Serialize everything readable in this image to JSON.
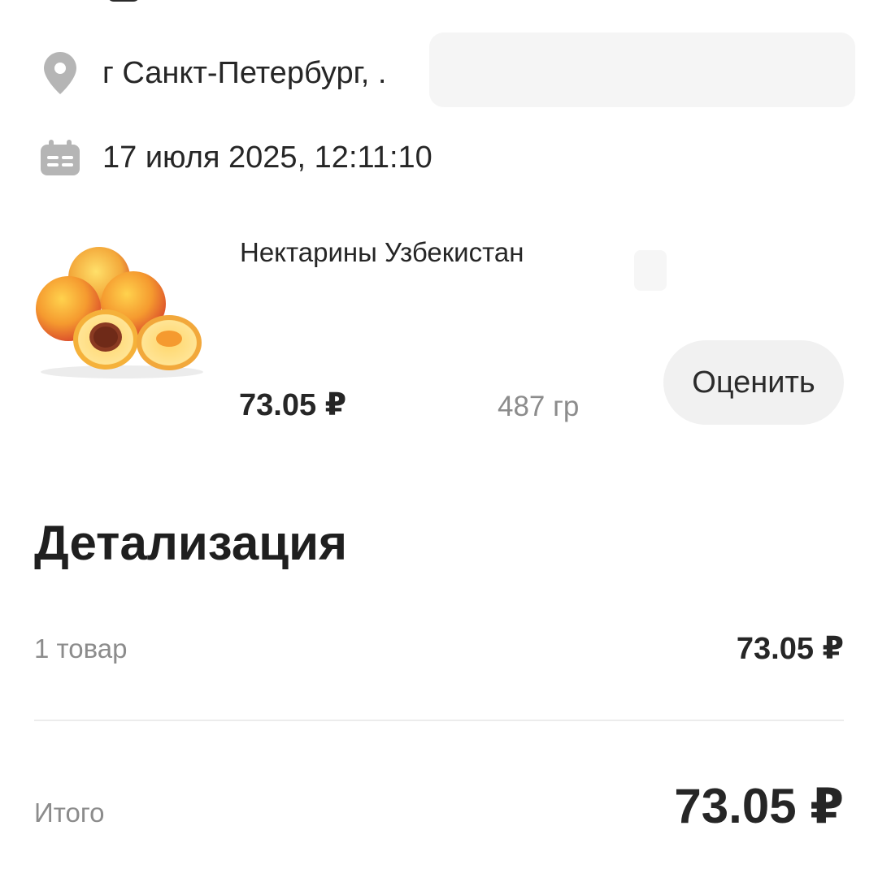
{
  "order": {
    "address": "г Санкт-Петербург, .",
    "datetime": "17 июля 2025, 12:11:10"
  },
  "item": {
    "name": "Нектарины Узбекистан",
    "price": "73.05 ₽",
    "weight": "487 гр",
    "rate_label": "Оценить",
    "image_icon": "nectarines-image"
  },
  "details": {
    "title": "Детализация",
    "items_label": "1 товар",
    "items_value": "73.05 ₽",
    "total_label": "Итого",
    "total_value": "73.05 ₽"
  },
  "icons": {
    "location": "location-pin-icon",
    "calendar": "calendar-icon"
  },
  "colors": {
    "icon_gray": "#b5b5b5",
    "button_bg": "#f1f1f1",
    "muted_text": "#8c8c8c",
    "primary_text": "#262626"
  }
}
